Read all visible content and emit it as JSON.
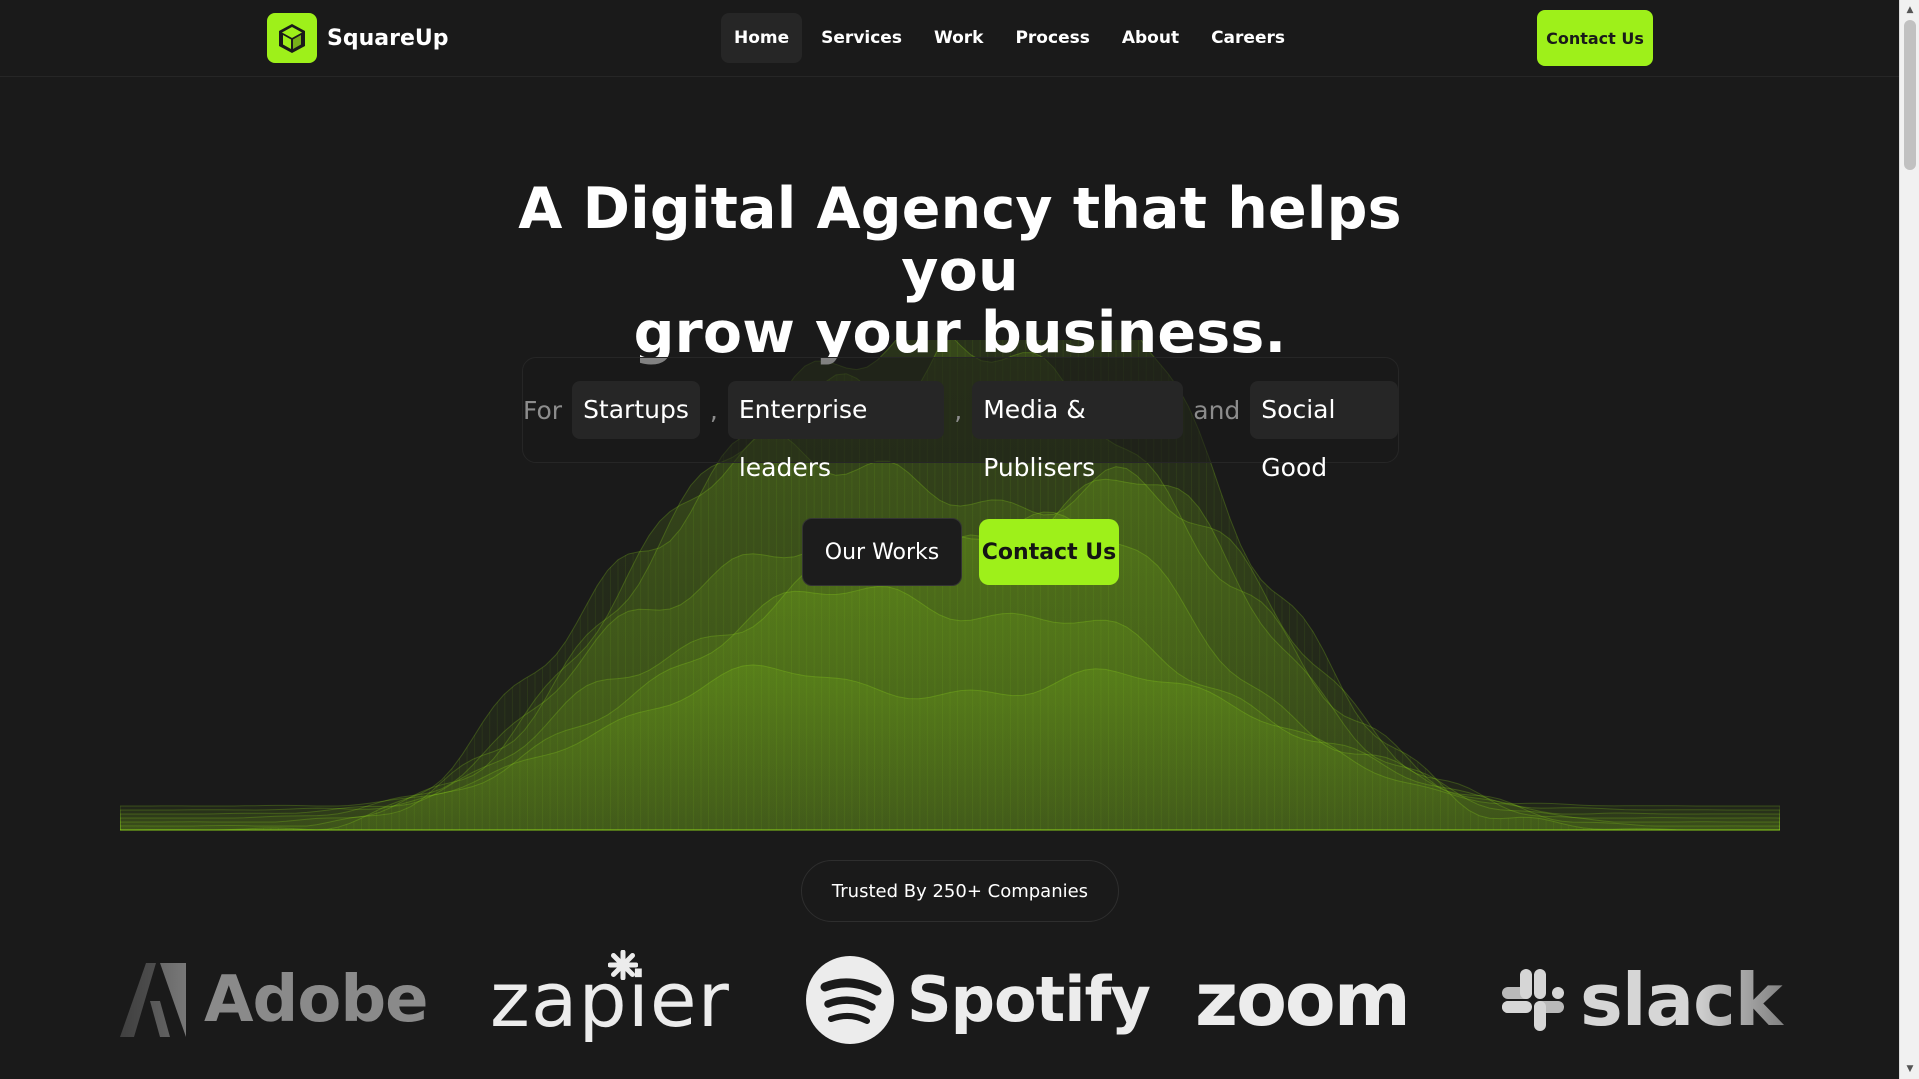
{
  "header": {
    "brand": "SquareUp",
    "nav": [
      {
        "label": "Home",
        "active": true
      },
      {
        "label": "Services",
        "active": false
      },
      {
        "label": "Work",
        "active": false
      },
      {
        "label": "Process",
        "active": false
      },
      {
        "label": "About",
        "active": false
      },
      {
        "label": "Careers",
        "active": false
      }
    ],
    "cta_label": "Contact Us",
    "logo_icon": "cube-icon"
  },
  "hero": {
    "title_line1": "A Digital Agency that helps you",
    "title_line2": "grow your business.",
    "audience": {
      "prefix": "For",
      "items": [
        "Startups",
        "Enterprise leaders",
        "Media & Publisers"
      ],
      "separator": ",",
      "conjunction": "and",
      "last": "Social Good"
    },
    "secondary_button": "Our Works",
    "primary_button": "Contact Us"
  },
  "trusted": {
    "label": "Trusted By 250+ Companies",
    "logos": [
      "Adobe",
      "zapier",
      "Spotify",
      "zoom",
      "slack"
    ]
  },
  "colors": {
    "background": "#1a1a1a",
    "accent": "#9ef01a",
    "surface": "#262626",
    "muted_text": "#8c8c8c"
  }
}
